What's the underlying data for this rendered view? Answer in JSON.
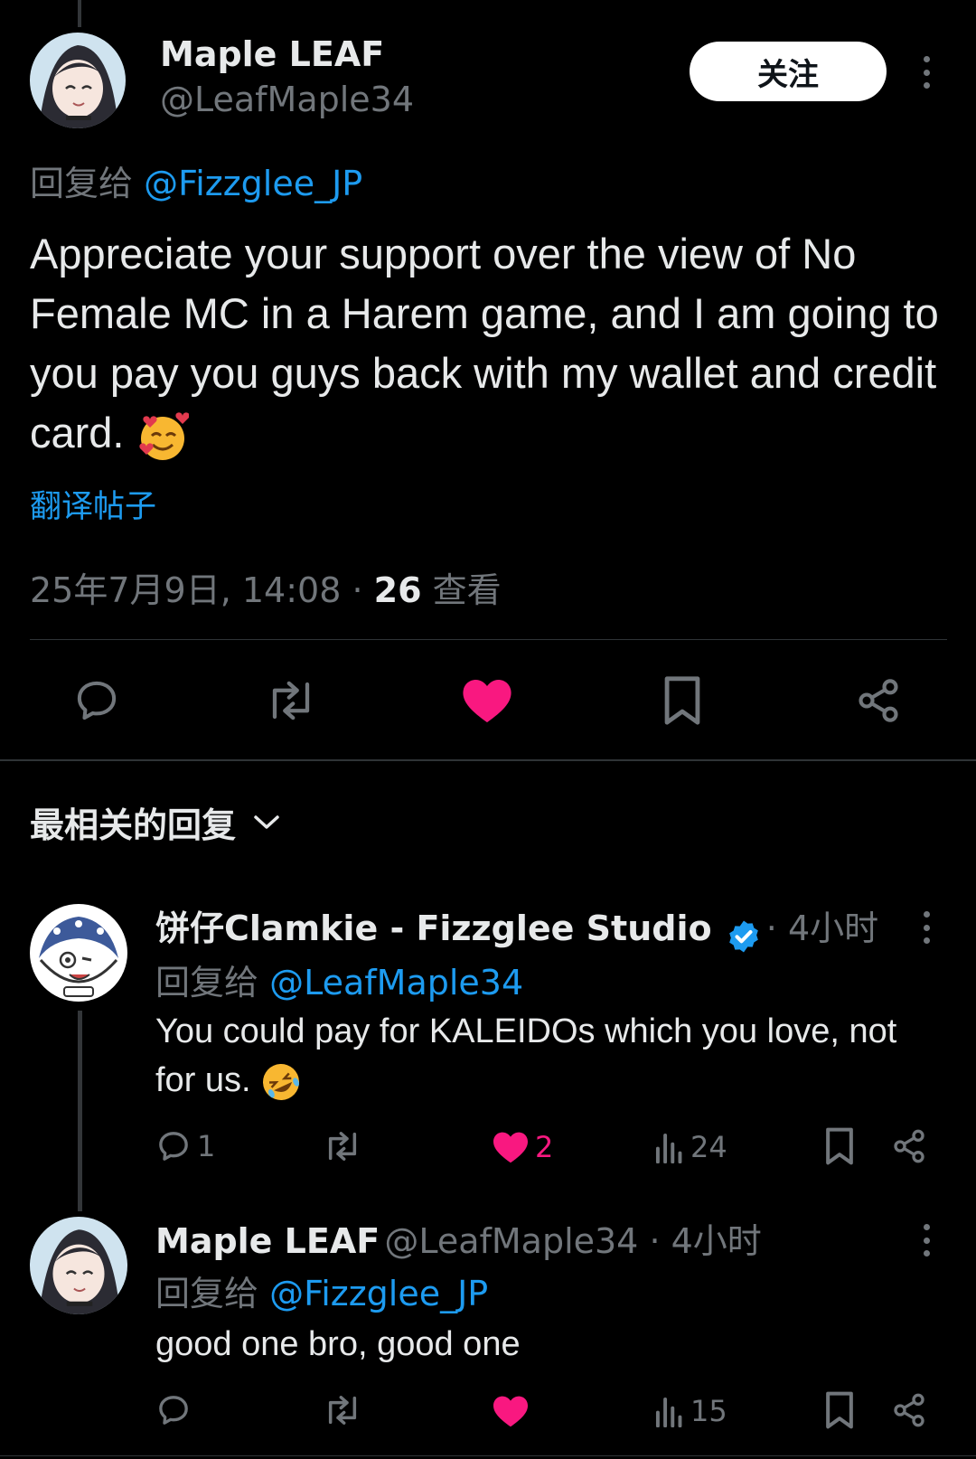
{
  "main_post": {
    "display_name": "Maple LEAF",
    "handle": "@LeafMaple34",
    "follow_label": "关注",
    "reply_prefix": "回复给",
    "reply_to": "@Fizzglee_JP",
    "text": "Appreciate your support over the view of No Female MC in a Harem game, and I am going to you pay you guys back with my wallet and credit card.",
    "translate_label": "翻译帖子",
    "timestamp": "25年7月9日, 14:08 · ",
    "views_count": "26",
    "views_label": " 查看"
  },
  "sort": {
    "label": "最相关的回复"
  },
  "replies": [
    {
      "display_name": "饼仔Clamkie - Fizzglee Studio",
      "time": " · 4小时",
      "reply_prefix": "回复给",
      "reply_to": "@LeafMaple34",
      "text": "You could pay for KALEIDOs which you love, not for us.",
      "reply_count": "1",
      "like_count": "2",
      "views": "24"
    },
    {
      "display_name": "Maple LEAF",
      "handle": "@LeafMaple34",
      "time": " · 4小时",
      "reply_prefix": "回复给",
      "reply_to": "@Fizzglee_JP",
      "text": "good one bro, good one",
      "views": "15"
    }
  ],
  "colors": {
    "accent_link": "#1d9bf0",
    "like_active": "#f91880",
    "muted": "#71767b",
    "background": "#000000"
  }
}
